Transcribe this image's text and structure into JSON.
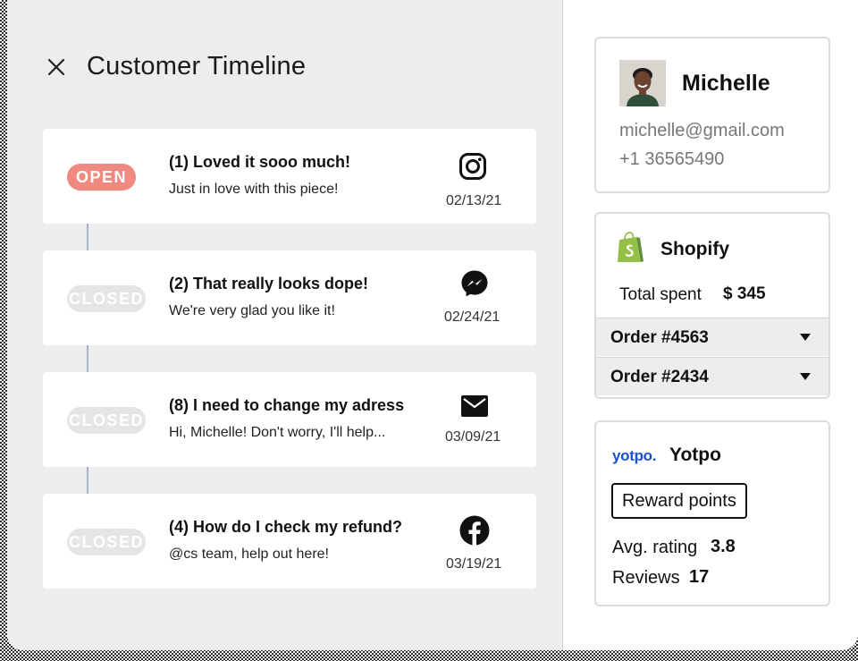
{
  "timeline": {
    "title": "Customer Timeline",
    "close_icon": "close-icon",
    "items": [
      {
        "status": "OPEN",
        "status_color": "#f08a80",
        "title": "(1) Loved it sooo much!",
        "body": "Just in love with this piece!",
        "channel": "instagram-icon",
        "date": "02/13/21"
      },
      {
        "status": "CLOSED",
        "status_color": "#e5e5e5",
        "title": "(2) That really looks dope!",
        "body": "We're very glad you like it!",
        "channel": "messenger-icon",
        "date": "02/24/21"
      },
      {
        "status": "CLOSED",
        "status_color": "#e5e5e5",
        "title": "(8) I need to change my adress",
        "body": "Hi, Michelle! Don't worry, I'll help...",
        "channel": "mail-icon",
        "date": "03/09/21"
      },
      {
        "status": "CLOSED",
        "status_color": "#e5e5e5",
        "title": "(4) How do I check my refund?",
        "body": "@cs team, help out here!",
        "channel": "facebook-icon",
        "date": "03/19/21"
      }
    ]
  },
  "customer": {
    "name": "Michelle",
    "email": "michelle@gmail.com",
    "phone": "+1 36565490"
  },
  "shopify": {
    "name": "Shopify",
    "brand_color": "#95bf47",
    "total_spent_label": "Total spent",
    "total_spent_value": "$ 345",
    "orders": [
      {
        "label": "Order #4563"
      },
      {
        "label": "Order #2434"
      }
    ]
  },
  "yotpo": {
    "logo_text": "yotpo.",
    "name": "Yotpo",
    "brand_color": "#1a4fd6",
    "reward_button": "Reward points",
    "rating_label": "Avg. rating",
    "rating_value": "3.8",
    "reviews_label": "Reviews",
    "reviews_value": "17"
  }
}
